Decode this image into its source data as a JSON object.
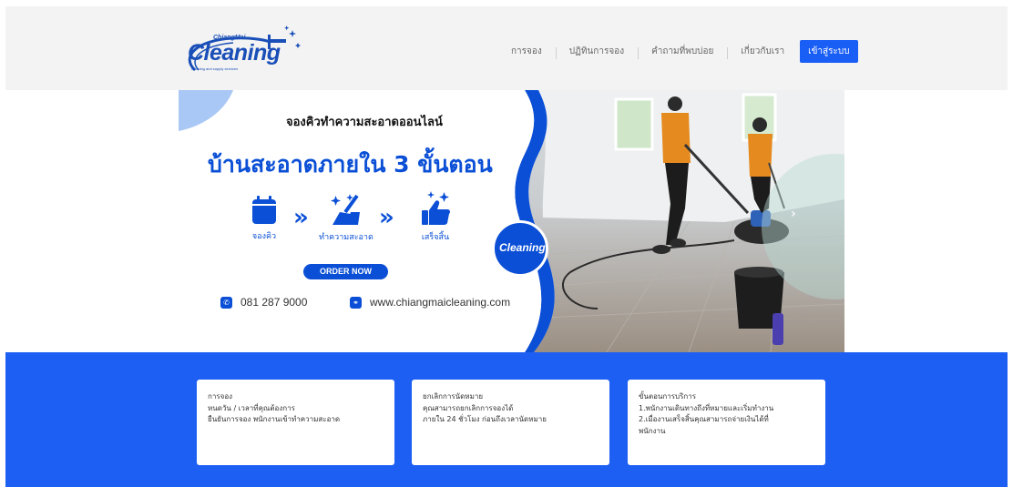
{
  "header": {
    "logo": {
      "top": "ChiangMai",
      "main": "Cleaning",
      "sub": "cleaning and supply services"
    },
    "nav": [
      {
        "label": "การจอง"
      },
      {
        "label": "ปฏิทินการจอง"
      },
      {
        "label": "คำถามที่พบบ่อย"
      },
      {
        "label": "เกี่ยวกับเรา"
      }
    ],
    "login_label": "เข้าสู่ระบบ"
  },
  "hero": {
    "heading_small": "จองคิวทำความสะอาดออนไลน์",
    "heading_big": "บ้านสะอาดภายใน 3 ขั้นตอน",
    "steps": [
      {
        "label": "จองคิว",
        "icon": "calendar-icon"
      },
      {
        "label": "ทำความสะอาด",
        "icon": "broom-sparkle-icon"
      },
      {
        "label": "เสร็จสิ้น",
        "icon": "thumbs-up-icon"
      }
    ],
    "order_button": "ORDER NOW",
    "phone": "081 287 9000",
    "website": "www.chiangmaicleaning.com",
    "badge_text": "Cleaning",
    "next_arrow": "›"
  },
  "cards": [
    {
      "lines": [
        "การจอง",
        "หนดวัน / เวลาที่คุณต้องการ",
        "ยืนยันการจอง พนักงานเข้าทำความสะอาด"
      ]
    },
    {
      "lines": [
        "ยกเลิกการนัดหมาย",
        "คุณสามารถยกเลิกการจองได้",
        "ภายใน 24 ชั่วโมง ก่อนถึงเวลานัดหมาย"
      ]
    },
    {
      "lines": [
        "ขั้นตอนการบริการ",
        "1.พนักงานเดินทางถึงที่หมายและเริ่มทำงาน",
        "2.เมื่องานเสร็จสิ้นคุณสามารถจ่ายเงินได้ที่",
        "พนักงาน"
      ]
    }
  ],
  "colors": {
    "brand_blue": "#1d5ff2",
    "dark_blue": "#0a4fd6",
    "header_bg": "#f3f3f3"
  }
}
